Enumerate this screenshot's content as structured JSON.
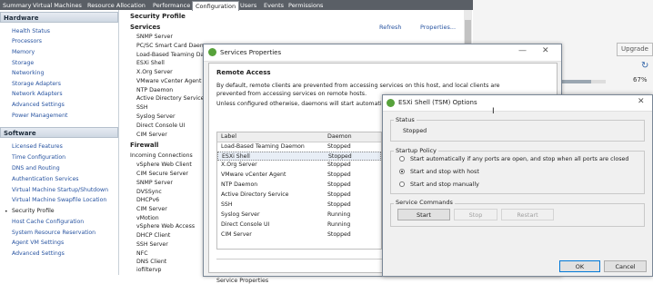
{
  "tabs": [
    "Summary",
    "Virtual Machines",
    "Resource Allocation",
    "Performance",
    "Configuration",
    "Users",
    "Events",
    "Permissions"
  ],
  "active_tab": "Configuration",
  "left_panel": {
    "hardware_title": "Hardware",
    "hardware_items": [
      "Health Status",
      "Processors",
      "Memory",
      "Storage",
      "Networking",
      "Storage Adapters",
      "Network Adapters",
      "Advanced Settings",
      "Power Management"
    ],
    "software_title": "Software",
    "software_items": [
      "Licensed Features",
      "Time Configuration",
      "DNS and Routing",
      "Authentication Services",
      "Virtual Machine Startup/Shutdown",
      "Virtual Machine Swapfile Location",
      "Security Profile",
      "Host Cache Configuration",
      "System Resource Reservation",
      "Agent VM Settings",
      "Advanced Settings"
    ],
    "bullet": "•"
  },
  "middle": {
    "security_profile": "Security Profile",
    "services": "Services",
    "refresh": "Refresh",
    "properties": "Properties...",
    "service_list": [
      "SNMP Server",
      "PC/SC Smart Card Daemon",
      "Load-Based Teaming Da",
      "ESXi Shell",
      "X.Org Server",
      "VMware vCenter Agent",
      "NTP Daemon",
      "Active Directory Service",
      "SSH",
      "Syslog Server",
      "Direct Console UI",
      "CIM Server"
    ],
    "firewall": "Firewall",
    "incoming": "Incoming Connections",
    "firewall_list": [
      "vSphere Web Client",
      "CIM Secure Server",
      "SNMP Server",
      "DVSSync",
      "DHCPv6",
      "CIM Server",
      "vMotion",
      "vSphere Web Access",
      "DHCP Client",
      "SSH Server",
      "NFC",
      "DNS Client",
      "iofiltervp"
    ]
  },
  "right": {
    "upgrade": "Upgrade",
    "refresh_icon": "↻",
    "progress_label": "67%",
    "progress_value": 0.67
  },
  "dialog1": {
    "title": "Services Properties",
    "min": "—",
    "close": "✕",
    "remote_access": "Remote Access",
    "desc": "By default, remote clients are prevented from accessing services on this host, and local clients are prevented from accessing services on remote hosts.",
    "note": "Unless configured otherwise, daemons will start automatically.",
    "col_label": "Label",
    "col_daemon": "Daemon",
    "rows": [
      {
        "label": "Load-Based Teaming Daemon",
        "daemon": "Stopped"
      },
      {
        "label": "ESXi Shell",
        "daemon": "Stopped"
      },
      {
        "label": "X.Org Server",
        "daemon": "Stopped"
      },
      {
        "label": "VMware vCenter Agent",
        "daemon": "Stopped"
      },
      {
        "label": "NTP Daemon",
        "daemon": "Stopped"
      },
      {
        "label": "Active Directory Service",
        "daemon": "Stopped"
      },
      {
        "label": "SSH",
        "daemon": "Stopped"
      },
      {
        "label": "Syslog Server",
        "daemon": "Running"
      },
      {
        "label": "Direct Console UI",
        "daemon": "Running"
      },
      {
        "label": "CIM Server",
        "daemon": "Stopped"
      }
    ],
    "service_properties": "Service Properties"
  },
  "dialog2": {
    "title": "ESXi Shell (TSM) Options",
    "close": "✕",
    "status_label": "Status",
    "status_value": "Stopped",
    "startup_policy": "Startup Policy",
    "options": [
      "Start automatically if any ports are open, and stop when all ports are closed",
      "Start and stop with host",
      "Start and stop manually"
    ],
    "selected_option": 1,
    "service_commands": "Service Commands",
    "start": "Start",
    "stop": "Stop",
    "restart": "Restart",
    "ok": "OK",
    "cancel": "Cancel"
  }
}
